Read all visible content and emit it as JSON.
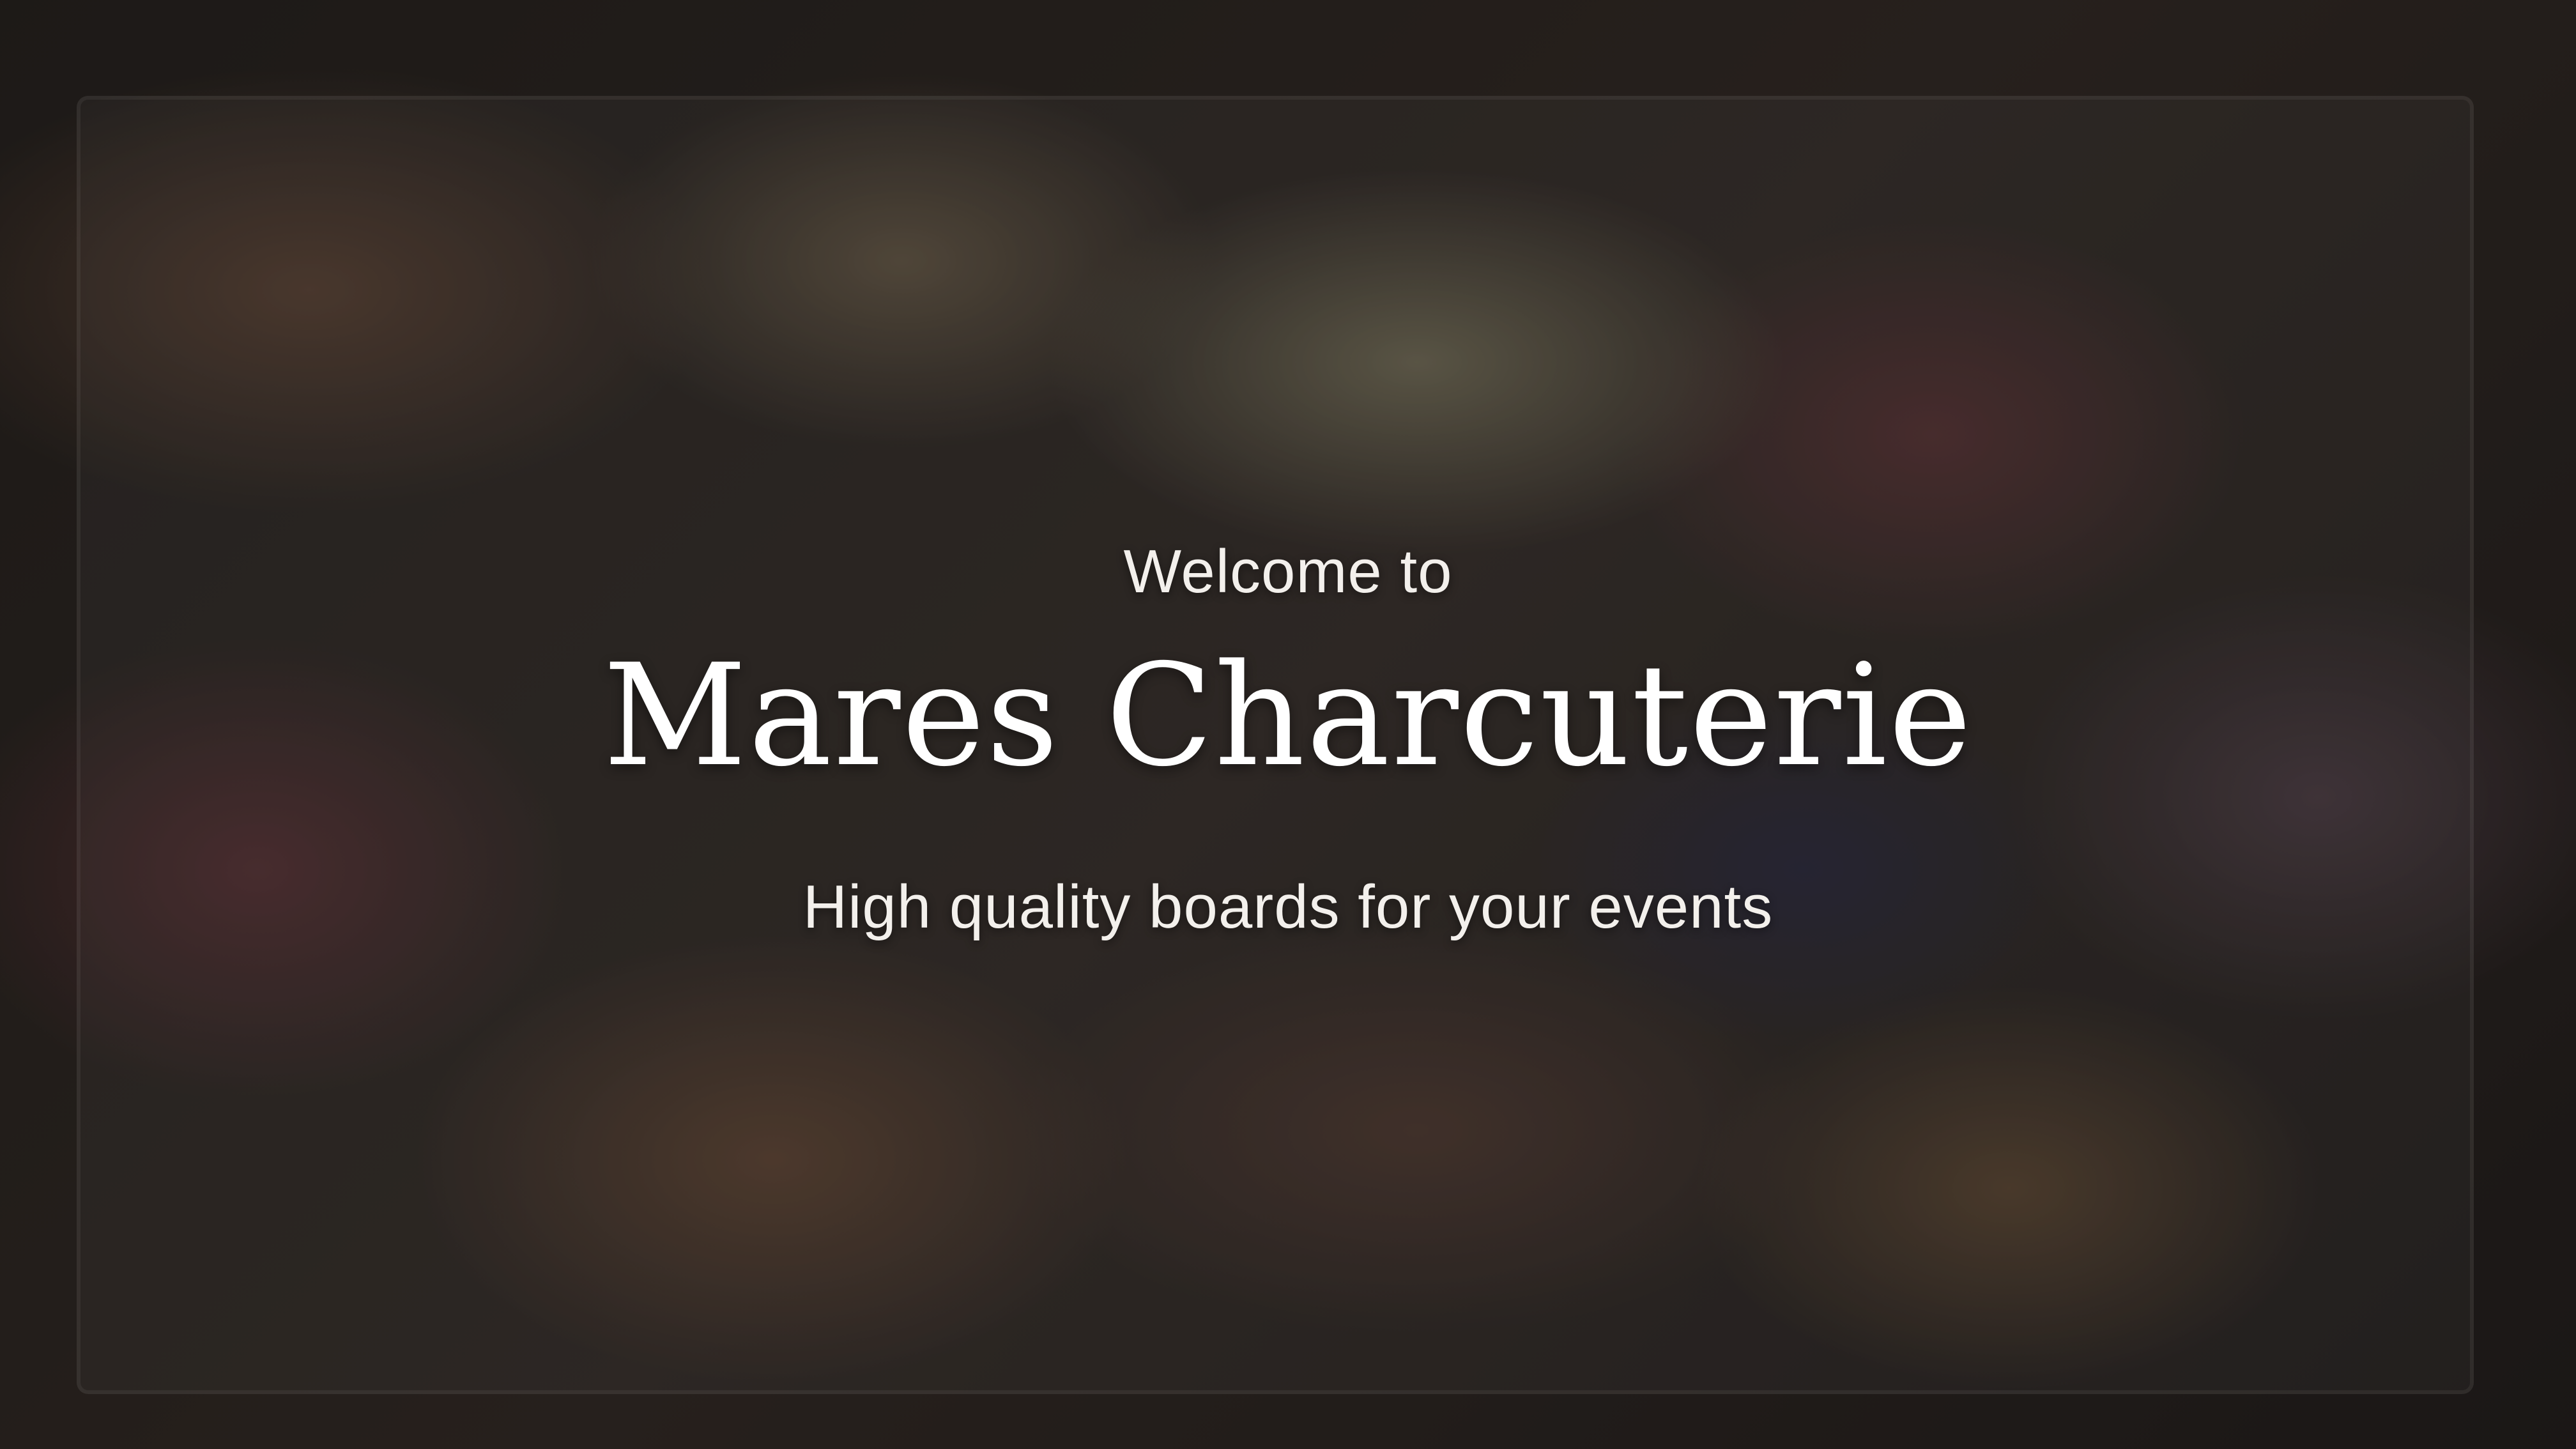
{
  "hero": {
    "welcome": "Welcome to",
    "title": "Mares Charcuterie",
    "tagline": "High quality boards for your events"
  },
  "colors": {
    "text": "#ffffff",
    "overlay": "#0c0a0a"
  }
}
